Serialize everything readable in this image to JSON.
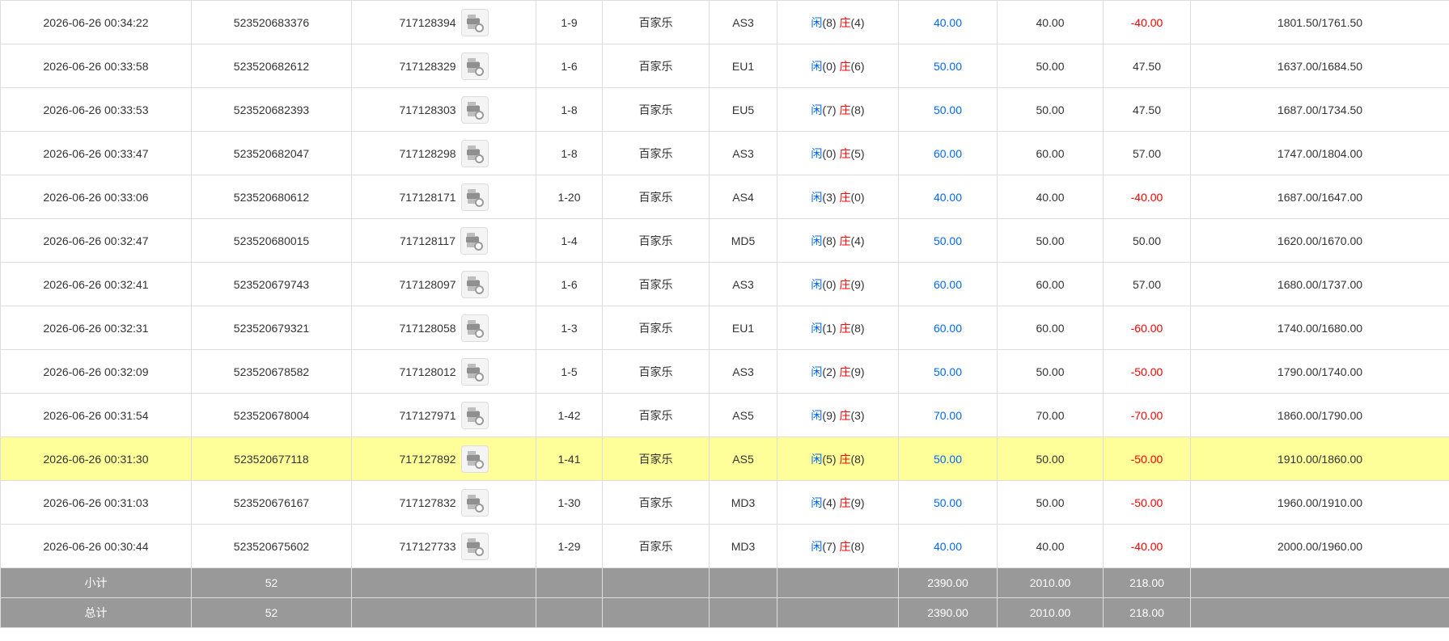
{
  "colors": {
    "blue": "#0066ff",
    "red": "#ff0000",
    "highlight": "#ffff99",
    "summary_bg": "#999999"
  },
  "icon": "replay-video-icon",
  "rows": [
    {
      "time": "2026-06-26 00:34:22",
      "bet_id": "523520683376",
      "round_id": "717128394",
      "shoe": "1-9",
      "game": "百家乐",
      "table": "AS3",
      "player_label": "闲",
      "player_pts": "(8)",
      "banker_label": "庄",
      "banker_pts": "(4)",
      "bet": "40.00",
      "valid": "40.00",
      "winloss": "-40.00",
      "winloss_color": "red",
      "balance": "1801.50/1761.50"
    },
    {
      "time": "2026-06-26 00:33:58",
      "bet_id": "523520682612",
      "round_id": "717128329",
      "shoe": "1-6",
      "game": "百家乐",
      "table": "EU1",
      "player_label": "闲",
      "player_pts": "(0)",
      "banker_label": "庄",
      "banker_pts": "(6)",
      "bet": "50.00",
      "valid": "50.00",
      "winloss": "47.50",
      "winloss_color": "black",
      "balance": "1637.00/1684.50"
    },
    {
      "time": "2026-06-26 00:33:53",
      "bet_id": "523520682393",
      "round_id": "717128303",
      "shoe": "1-8",
      "game": "百家乐",
      "table": "EU5",
      "player_label": "闲",
      "player_pts": "(7)",
      "banker_label": "庄",
      "banker_pts": "(8)",
      "bet": "50.00",
      "valid": "50.00",
      "winloss": "47.50",
      "winloss_color": "black",
      "balance": "1687.00/1734.50"
    },
    {
      "time": "2026-06-26 00:33:47",
      "bet_id": "523520682047",
      "round_id": "717128298",
      "shoe": "1-8",
      "game": "百家乐",
      "table": "AS3",
      "player_label": "闲",
      "player_pts": "(0)",
      "banker_label": "庄",
      "banker_pts": "(5)",
      "bet": "60.00",
      "valid": "60.00",
      "winloss": "57.00",
      "winloss_color": "black",
      "balance": "1747.00/1804.00"
    },
    {
      "time": "2026-06-26 00:33:06",
      "bet_id": "523520680612",
      "round_id": "717128171",
      "shoe": "1-20",
      "game": "百家乐",
      "table": "AS4",
      "player_label": "闲",
      "player_pts": "(3)",
      "banker_label": "庄",
      "banker_pts": "(0)",
      "bet": "40.00",
      "valid": "40.00",
      "winloss": "-40.00",
      "winloss_color": "red",
      "balance": "1687.00/1647.00"
    },
    {
      "time": "2026-06-26 00:32:47",
      "bet_id": "523520680015",
      "round_id": "717128117",
      "shoe": "1-4",
      "game": "百家乐",
      "table": "MD5",
      "player_label": "闲",
      "player_pts": "(8)",
      "banker_label": "庄",
      "banker_pts": "(4)",
      "bet": "50.00",
      "valid": "50.00",
      "winloss": "50.00",
      "winloss_color": "black",
      "balance": "1620.00/1670.00"
    },
    {
      "time": "2026-06-26 00:32:41",
      "bet_id": "523520679743",
      "round_id": "717128097",
      "shoe": "1-6",
      "game": "百家乐",
      "table": "AS3",
      "player_label": "闲",
      "player_pts": "(0)",
      "banker_label": "庄",
      "banker_pts": "(9)",
      "bet": "60.00",
      "valid": "60.00",
      "winloss": "57.00",
      "winloss_color": "black",
      "balance": "1680.00/1737.00"
    },
    {
      "time": "2026-06-26 00:32:31",
      "bet_id": "523520679321",
      "round_id": "717128058",
      "shoe": "1-3",
      "game": "百家乐",
      "table": "EU1",
      "player_label": "闲",
      "player_pts": "(1)",
      "banker_label": "庄",
      "banker_pts": "(8)",
      "bet": "60.00",
      "valid": "60.00",
      "winloss": "-60.00",
      "winloss_color": "red",
      "balance": "1740.00/1680.00"
    },
    {
      "time": "2026-06-26 00:32:09",
      "bet_id": "523520678582",
      "round_id": "717128012",
      "shoe": "1-5",
      "game": "百家乐",
      "table": "AS3",
      "player_label": "闲",
      "player_pts": "(2)",
      "banker_label": "庄",
      "banker_pts": "(9)",
      "bet": "50.00",
      "valid": "50.00",
      "winloss": "-50.00",
      "winloss_color": "red",
      "balance": "1790.00/1740.00"
    },
    {
      "time": "2026-06-26 00:31:54",
      "bet_id": "523520678004",
      "round_id": "717127971",
      "shoe": "1-42",
      "game": "百家乐",
      "table": "AS5",
      "player_label": "闲",
      "player_pts": "(9)",
      "banker_label": "庄",
      "banker_pts": "(3)",
      "bet": "70.00",
      "valid": "70.00",
      "winloss": "-70.00",
      "winloss_color": "red",
      "balance": "1860.00/1790.00"
    },
    {
      "time": "2026-06-26 00:31:30",
      "bet_id": "523520677118",
      "round_id": "717127892",
      "shoe": "1-41",
      "game": "百家乐",
      "table": "AS5",
      "player_label": "闲",
      "player_pts": "(5)",
      "banker_label": "庄",
      "banker_pts": "(8)",
      "bet": "50.00",
      "valid": "50.00",
      "winloss": "-50.00",
      "winloss_color": "red",
      "balance": "1910.00/1860.00",
      "highlighted": true
    },
    {
      "time": "2026-06-26 00:31:03",
      "bet_id": "523520676167",
      "round_id": "717127832",
      "shoe": "1-30",
      "game": "百家乐",
      "table": "MD3",
      "player_label": "闲",
      "player_pts": "(4)",
      "banker_label": "庄",
      "banker_pts": "(9)",
      "bet": "50.00",
      "valid": "50.00",
      "winloss": "-50.00",
      "winloss_color": "red",
      "balance": "1960.00/1910.00"
    },
    {
      "time": "2026-06-26 00:30:44",
      "bet_id": "523520675602",
      "round_id": "717127733",
      "shoe": "1-29",
      "game": "百家乐",
      "table": "MD3",
      "player_label": "闲",
      "player_pts": "(7)",
      "banker_label": "庄",
      "banker_pts": "(8)",
      "bet": "40.00",
      "valid": "40.00",
      "winloss": "-40.00",
      "winloss_color": "red",
      "balance": "2000.00/1960.00"
    }
  ],
  "subtotal": {
    "label": "小计",
    "count": "52",
    "bet": "2390.00",
    "valid": "2010.00",
    "winloss": "218.00"
  },
  "total": {
    "label": "总计",
    "count": "52",
    "bet": "2390.00",
    "valid": "2010.00",
    "winloss": "218.00"
  }
}
